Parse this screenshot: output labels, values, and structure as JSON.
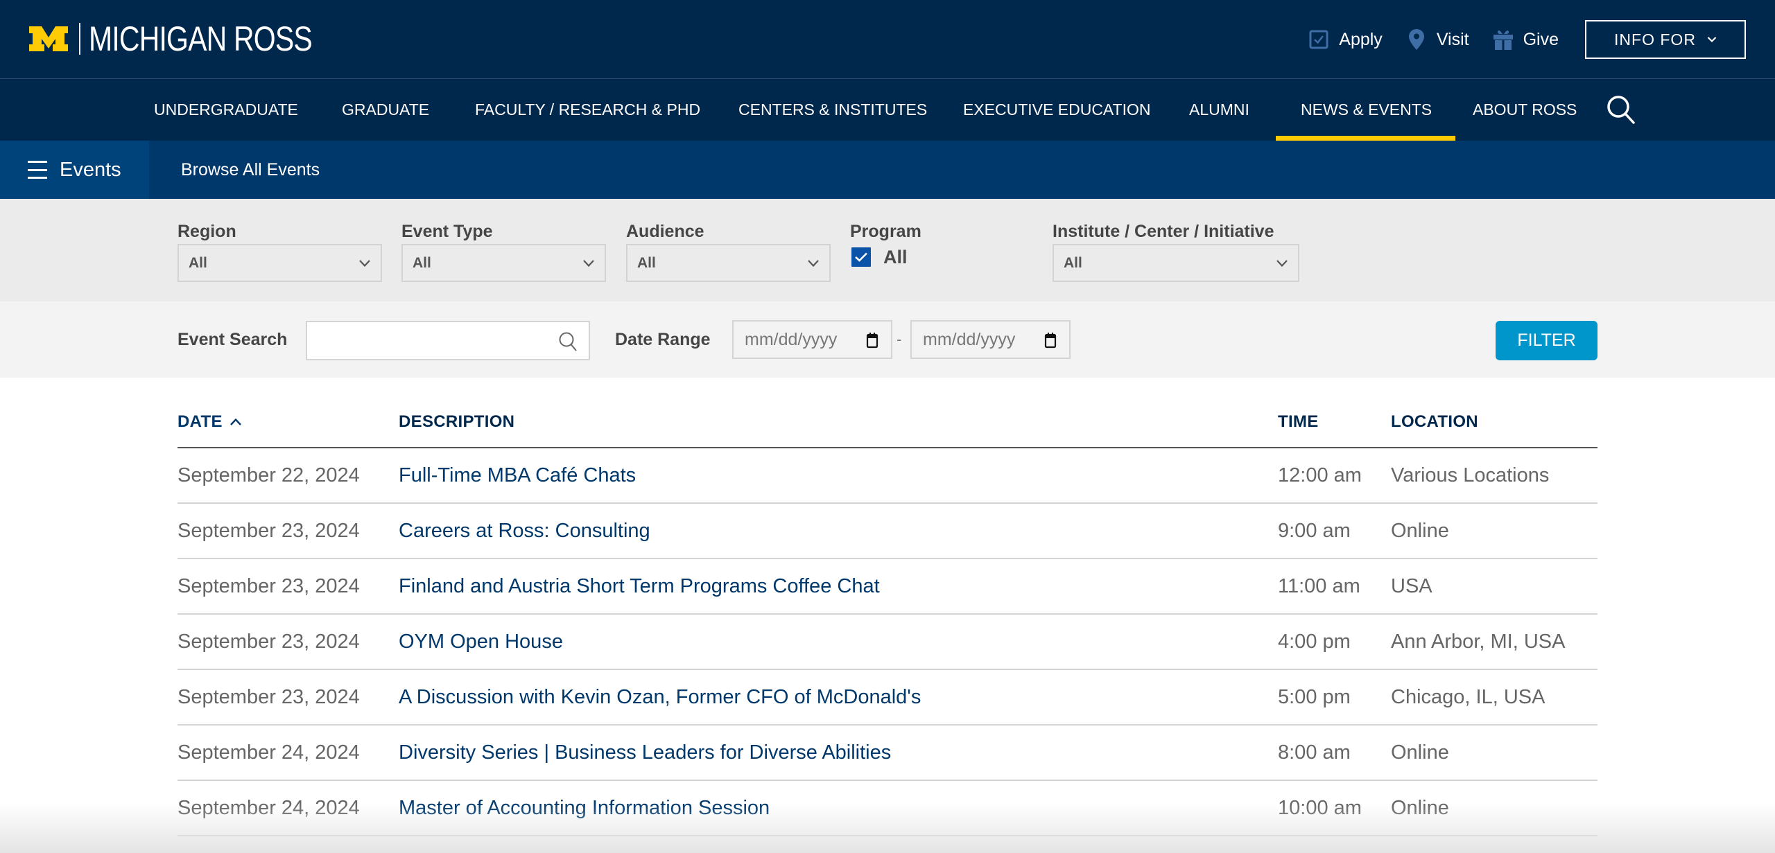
{
  "brand": {
    "logo_mark": "M",
    "logo_text": "MICHIGAN ROSS",
    "colors": {
      "navy": "#00274c",
      "maize": "#ffcb05",
      "events_bar": "#00386b",
      "filter_button": "#0096cc",
      "checkbox": "#0a53a8",
      "link": "#00386b"
    }
  },
  "utility_nav": {
    "links": [
      {
        "label": "Apply",
        "icon": "checkbox-icon"
      },
      {
        "label": "Visit",
        "icon": "map-pin-icon"
      },
      {
        "label": "Give",
        "icon": "gift-icon"
      }
    ],
    "info_for": "INFO FOR"
  },
  "main_nav": {
    "items": [
      {
        "label": "UNDERGRADUATE"
      },
      {
        "label": "GRADUATE"
      },
      {
        "label": "FACULTY / RESEARCH & PHD"
      },
      {
        "label": "CENTERS & INSTITUTES"
      },
      {
        "label": "EXECUTIVE EDUCATION"
      },
      {
        "label": "ALUMNI"
      },
      {
        "label": "NEWS & EVENTS",
        "active": true
      },
      {
        "label": "ABOUT ROSS"
      }
    ],
    "search_icon": "search-icon"
  },
  "events_bar": {
    "section_label": "Events",
    "browse_link": "Browse All Events"
  },
  "filters": {
    "region": {
      "label": "Region",
      "value": "All"
    },
    "event_type": {
      "label": "Event Type",
      "value": "All"
    },
    "audience": {
      "label": "Audience",
      "value": "All"
    },
    "program": {
      "label": "Program",
      "option": "All",
      "checked": true
    },
    "institute": {
      "label": "Institute / Center / Initiative",
      "value": "All"
    }
  },
  "search": {
    "event_search_label": "Event Search",
    "event_search_value": "",
    "date_range_label": "Date Range",
    "date_from_placeholder": "mm/dd/yyyy",
    "date_to_placeholder": "mm/dd/yyyy",
    "date_separator": "-",
    "filter_button": "FILTER"
  },
  "table": {
    "headers": {
      "date": "DATE",
      "description": "DESCRIPTION",
      "time": "TIME",
      "location": "LOCATION"
    },
    "sort": {
      "column": "date",
      "direction": "ascending"
    },
    "rows": [
      {
        "date": "September 22, 2024",
        "description": "Full-Time MBA Café Chats",
        "time": "12:00 am",
        "location": "Various Locations"
      },
      {
        "date": "September 23, 2024",
        "description": "Careers at Ross: Consulting",
        "time": "9:00 am",
        "location": "Online"
      },
      {
        "date": "September 23, 2024",
        "description": "Finland and Austria Short Term Programs Coffee Chat",
        "time": "11:00 am",
        "location": "USA"
      },
      {
        "date": "September 23, 2024",
        "description": "OYM Open House",
        "time": "4:00 pm",
        "location": "Ann Arbor, MI, USA"
      },
      {
        "date": "September 23, 2024",
        "description": "A Discussion with Kevin Ozan, Former CFO of McDonald's",
        "time": "5:00 pm",
        "location": "Chicago, IL, USA"
      },
      {
        "date": "September 24, 2024",
        "description": "Diversity Series | Business Leaders for Diverse Abilities",
        "time": "8:00 am",
        "location": "Online"
      },
      {
        "date": "September 24, 2024",
        "description": "Master of Accounting Information Session",
        "time": "10:00 am",
        "location": "Online"
      }
    ]
  }
}
